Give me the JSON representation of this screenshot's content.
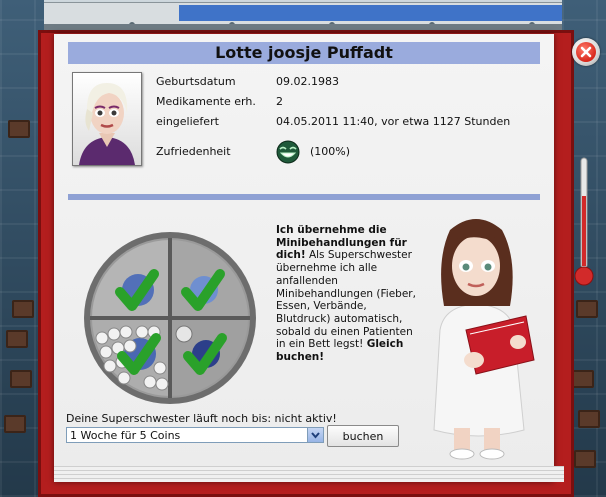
{
  "patient": {
    "name": "Lotte joosje Puffadt",
    "fields": [
      {
        "label": "Geburtsdatum",
        "value": "09.02.1983"
      },
      {
        "label": "Medikamente erh.",
        "value": "2"
      },
      {
        "label": "eingeliefert",
        "value": "04.05.2011 11:40, vor etwa 1127 Stunden"
      }
    ],
    "satisfaction": {
      "label": "Zufriedenheit",
      "value": "(100%)",
      "icon": "happy-face-icon"
    }
  },
  "offer": {
    "headline": "Ich übernehme die Minibehandlungen für dich!",
    "body": " Als Superschwester übernehme ich alle anfallenden Minibehandlungen (Fieber, Essen, Verbände, Blutdruck) automatisch, sobald du einen Patienten in ein Bett legst! ",
    "cta": "Gleich buchen!",
    "status": "Deine Superschwester läuft noch bis: nicht aktiv!",
    "option_selected": "1 Woche für 5 Coins",
    "buy_label": "buchen"
  },
  "colors": {
    "accent": "#9aabdd",
    "frame": "#b41e1e",
    "check": "#2aa12a"
  }
}
